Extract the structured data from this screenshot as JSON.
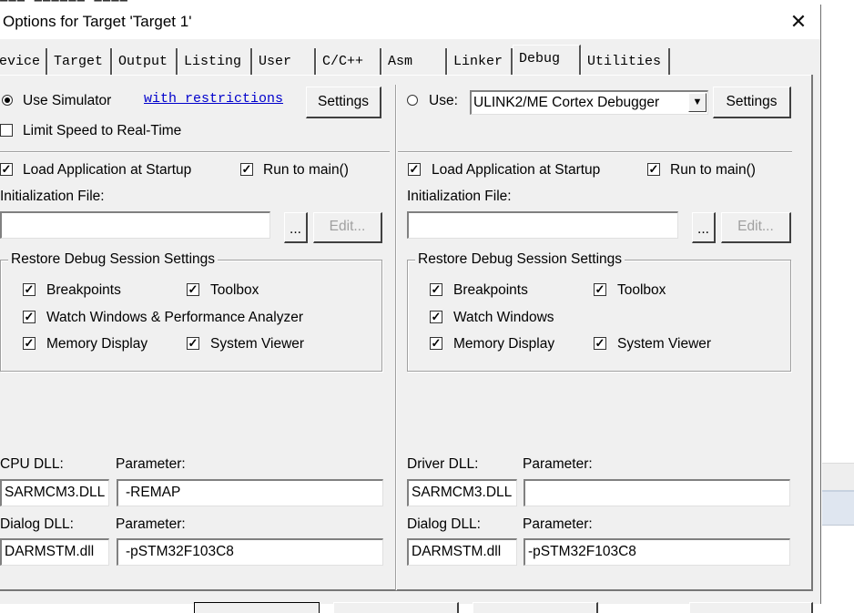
{
  "window": {
    "title": "Options for Target 'Target 1'"
  },
  "tabs": [
    {
      "label": "evice"
    },
    {
      "label": "Target"
    },
    {
      "label": "Output"
    },
    {
      "label": "Listing"
    },
    {
      "label": "User"
    },
    {
      "label": "C/C++"
    },
    {
      "label": "Asm"
    },
    {
      "label": "Linker"
    },
    {
      "label": "Debug"
    },
    {
      "label": "Utilities"
    }
  ],
  "active_tab": "Debug",
  "left": {
    "use_simulator": "Use Simulator",
    "with_restrictions": "with restrictions",
    "settings": "Settings",
    "limit_speed": "Limit Speed to Real-Time",
    "load_app": "Load Application at Startup",
    "run_to_main": "Run to main()",
    "init_file_label": "Initialization File:",
    "init_file_value": "",
    "browse": "...",
    "edit": "Edit...",
    "restore_title": "Restore Debug Session Settings",
    "breakpoints": "Breakpoints",
    "toolbox": "Toolbox",
    "watch_windows": "Watch Windows & Performance Analyzer",
    "memory_display": "Memory Display",
    "system_viewer": "System Viewer",
    "cpu_dll_label": "CPU DLL:",
    "cpu_param_label": "Parameter:",
    "cpu_dll": "SARMCM3.DLL",
    "cpu_param": "-REMAP",
    "dialog_dll_label": "Dialog DLL:",
    "dialog_param_label": "Parameter:",
    "dialog_dll": "DARMSTM.dll",
    "dialog_param": "-pSTM32F103C8"
  },
  "right": {
    "use": "Use:",
    "debugger": "ULINK2/ME Cortex Debugger",
    "settings": "Settings",
    "load_app": "Load Application at Startup",
    "run_to_main": "Run to main()",
    "init_file_label": "Initialization File:",
    "init_file_value": "",
    "browse": "...",
    "edit": "Edit...",
    "restore_title": "Restore Debug Session Settings",
    "breakpoints": "Breakpoints",
    "toolbox": "Toolbox",
    "watch_windows": "Watch Windows",
    "memory_display": "Memory Display",
    "system_viewer": "System Viewer",
    "driver_dll_label": "Driver DLL:",
    "driver_param_label": "Parameter:",
    "driver_dll": "SARMCM3.DLL",
    "driver_param": "",
    "dialog_dll_label": "Dialog DLL:",
    "dialog_param_label": "Parameter:",
    "dialog_dll": "DARMSTM.dll",
    "dialog_param": "-pSTM32F103C8"
  },
  "state": {
    "use_simulator": true,
    "use_target": false,
    "limit_speed": false,
    "left_load_app": true,
    "left_run_to_main": true,
    "left_breakpoints": true,
    "left_toolbox": true,
    "left_watch": true,
    "left_memory": true,
    "left_sysviewer": true,
    "right_load_app": true,
    "right_run_to_main": true,
    "right_breakpoints": true,
    "right_toolbox": true,
    "right_watch": true,
    "right_memory": true,
    "right_sysviewer": true
  },
  "colors": {
    "dialog_bg": "#f0f0f0",
    "link": "#0000cc"
  },
  "icons": {
    "close": "close-icon",
    "check": "checkmark-icon",
    "dropdown": "chevron-down-icon"
  }
}
